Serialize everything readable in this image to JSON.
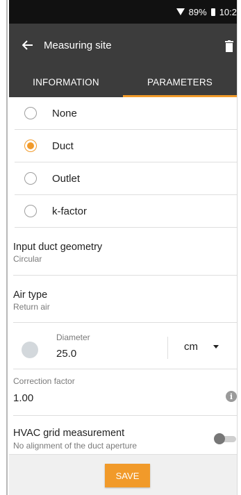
{
  "statusbar": {
    "battery_percent": "89%",
    "time": "10:2"
  },
  "appbar": {
    "title": "Measuring site"
  },
  "tabs": [
    {
      "label": "INFORMATION",
      "active": false
    },
    {
      "label": "PARAMETERS",
      "active": true
    }
  ],
  "radio_options": [
    {
      "label": "None",
      "checked": false
    },
    {
      "label": "Duct",
      "checked": true
    },
    {
      "label": "Outlet",
      "checked": false
    },
    {
      "label": "k-factor",
      "checked": false
    }
  ],
  "duct_geometry": {
    "label": "Input duct geometry",
    "value": "Circular"
  },
  "air_type": {
    "label": "Air type",
    "value": "Return air"
  },
  "diameter": {
    "label": "Diameter",
    "value": "25.0",
    "unit": "cm"
  },
  "correction_factor": {
    "label": "Correction factor",
    "value": "1.00"
  },
  "hvac": {
    "title": "HVAC grid measurement",
    "subtitle": "No alignment of the duct aperture",
    "enabled": false
  },
  "save_label": "SAVE",
  "colors": {
    "accent": "#f19a2a",
    "appbar": "#3c3c3c",
    "statusbar": "#111111"
  }
}
